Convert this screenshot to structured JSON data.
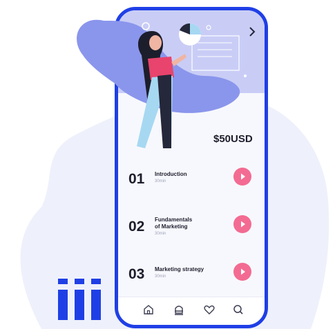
{
  "price": "$50USD",
  "lessons": [
    {
      "number": "01",
      "title": "Introduction",
      "duration": "30min"
    },
    {
      "number": "02",
      "title_line1": "Fundamentals",
      "title_line2": "of Marketing",
      "duration": "30min"
    },
    {
      "number": "03",
      "title": "Marketing strategy",
      "duration": "30min"
    }
  ],
  "nav": {
    "prev_icon": "chevron-left-icon",
    "next_icon": "chevron-right-icon"
  },
  "tabs": [
    "home-icon",
    "courses-icon",
    "heart-icon",
    "search-icon"
  ],
  "colors": {
    "phone_frame": "#1f3fe6",
    "hero_bg": "#c9cdf6",
    "blob": "#8a96ec",
    "play": "#f36b92",
    "logo_bars": "#1f3fe6"
  }
}
